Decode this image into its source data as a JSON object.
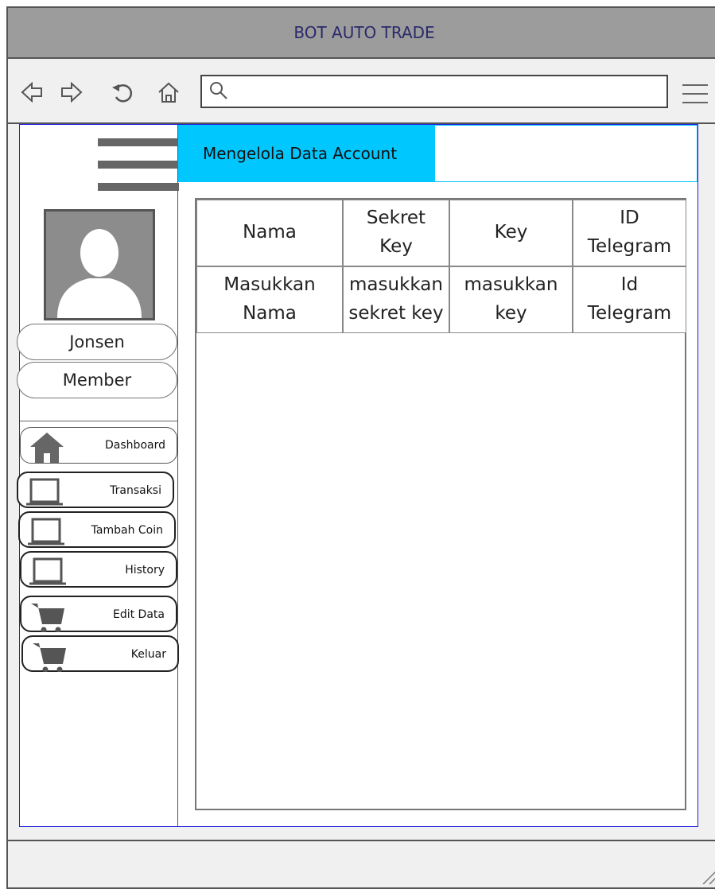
{
  "window": {
    "title": "BOT AUTO TRADE"
  },
  "browser": {
    "search_value": "",
    "search_placeholder": ""
  },
  "sidebar": {
    "user_name": "Jonsen",
    "user_role": "Member",
    "menu": [
      {
        "label": "Dashboard",
        "icon": "home-icon"
      },
      {
        "label": "Transaksi",
        "icon": "laptop-icon"
      },
      {
        "label": "Tambah Coin",
        "icon": "laptop-icon"
      },
      {
        "label": "History",
        "icon": "laptop-icon"
      },
      {
        "label": "Edit Data",
        "icon": "cart-icon"
      },
      {
        "label": "Keluar",
        "icon": "cart-icon"
      }
    ]
  },
  "main": {
    "header_title": "Mengelola Data Account",
    "table": {
      "headers": [
        "Nama",
        "Sekret Key",
        "Key",
        "ID Telegram"
      ],
      "row": [
        "Masukkan Nama",
        "masukkan sekret key",
        "masukkan key",
        "Id Telegram"
      ]
    }
  },
  "colors": {
    "accent": "#00c8ff",
    "titlebar": "#9c9c9c",
    "content_border": "#2020e0"
  }
}
